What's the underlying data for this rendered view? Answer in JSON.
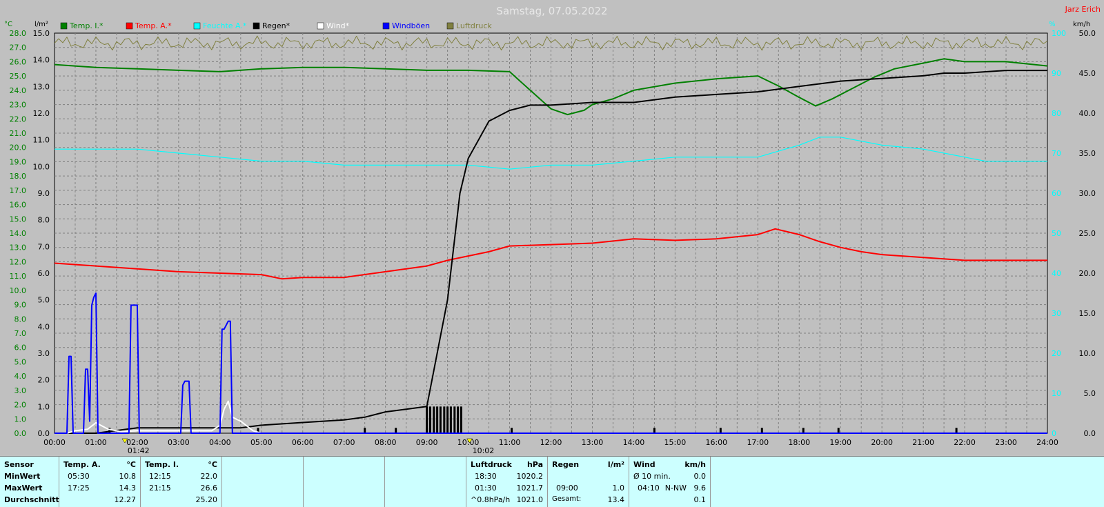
{
  "title": "Samstag, 07.05.2022",
  "author": "Jarz Erich",
  "axes": {
    "left1_unit": "°C",
    "left2_unit": "l/m²",
    "right1_unit": "%",
    "right2_unit": "km/h",
    "left1_ticks": [
      "0.0",
      "1.0",
      "2.0",
      "3.0",
      "4.0",
      "5.0",
      "6.0",
      "7.0",
      "8.0",
      "9.0",
      "10.0",
      "11.0",
      "12.0",
      "13.0",
      "14.0",
      "15.0",
      "16.0",
      "17.0",
      "18.0",
      "19.0",
      "20.0",
      "21.0",
      "22.0",
      "23.0",
      "24.0",
      "25.0",
      "26.0",
      "27.0",
      "28.0"
    ],
    "left2_ticks": [
      "0.0",
      "1.0",
      "2.0",
      "3.0",
      "4.0",
      "5.0",
      "6.0",
      "7.0",
      "8.0",
      "9.0",
      "10.0",
      "11.0",
      "12.0",
      "13.0",
      "14.0",
      "15.0"
    ],
    "right1_ticks": [
      "0",
      "10",
      "20",
      "30",
      "40",
      "50",
      "60",
      "70",
      "80",
      "90",
      "100"
    ],
    "right2_ticks": [
      "0.0",
      "5.0",
      "10.0",
      "15.0",
      "20.0",
      "25.0",
      "30.0",
      "35.0",
      "40.0",
      "45.0",
      "50.0"
    ],
    "x_ticks": [
      "00:00",
      "01:00",
      "02:00",
      "03:00",
      "04:00",
      "05:00",
      "06:00",
      "07:00",
      "08:00",
      "09:00",
      "10:00",
      "11:00",
      "12:00",
      "13:00",
      "14:00",
      "15:00",
      "16:00",
      "17:00",
      "18:00",
      "19:00",
      "20:00",
      "21:00",
      "22:00",
      "23:00",
      "24:00"
    ],
    "sunrise": "01:42",
    "sunset": "10:02"
  },
  "colors": {
    "temp_i": "#008000",
    "temp_a": "#ff0000",
    "feuchte": "#00ffff",
    "regen": "#000000",
    "wind": "#ffffff",
    "windboeen": "#0000ff",
    "luftdruck": "#808040",
    "title": "#e8e8e8",
    "author": "#ff0000",
    "left_axis": "#008000",
    "right1_axis": "#00ffff"
  },
  "legend": [
    {
      "label": "Temp. I.*",
      "color": "#008000"
    },
    {
      "label": "Temp. A.*",
      "color": "#ff0000"
    },
    {
      "label": "Feuchte A.*",
      "color": "#00ffff"
    },
    {
      "label": "Regen*",
      "color": "#000000"
    },
    {
      "label": "Wind*",
      "color": "#ffffff"
    },
    {
      "label": "Windböen",
      "color": "#0000ff"
    },
    {
      "label": "Luftdruck",
      "color": "#808040"
    }
  ],
  "chart_data": {
    "type": "line",
    "x_unit": "hour",
    "xlim": [
      0,
      24
    ],
    "series": [
      {
        "name": "Temp. I.*",
        "axis": "left1",
        "ylim": [
          0,
          28
        ],
        "x": [
          0,
          1,
          2,
          3,
          4,
          5,
          6,
          7,
          8,
          9,
          10,
          11,
          11.5,
          12,
          12.4,
          12.8,
          13,
          13.5,
          14,
          15,
          16,
          17,
          17.5,
          18,
          18.4,
          18.8,
          19.2,
          19.8,
          20.3,
          21,
          21.5,
          22,
          23,
          24
        ],
        "y": [
          25.8,
          25.6,
          25.5,
          25.4,
          25.3,
          25.5,
          25.6,
          25.6,
          25.5,
          25.4,
          25.4,
          25.3,
          24.0,
          22.7,
          22.3,
          22.6,
          23.0,
          23.4,
          24.0,
          24.5,
          24.8,
          25.0,
          24.3,
          23.5,
          22.9,
          23.4,
          24.0,
          24.9,
          25.5,
          25.9,
          26.2,
          26.0,
          26.0,
          25.7
        ]
      },
      {
        "name": "Temp. A.*",
        "axis": "left1",
        "ylim": [
          0,
          28
        ],
        "x": [
          0,
          1,
          2,
          3,
          4,
          5,
          5.5,
          6,
          7,
          8,
          9,
          9.5,
          10,
          10.5,
          11,
          12,
          13,
          14,
          15,
          16,
          17,
          17.42,
          18,
          18.5,
          19,
          19.5,
          20,
          21,
          22,
          23,
          24
        ],
        "y": [
          11.9,
          11.7,
          11.5,
          11.3,
          11.2,
          11.1,
          10.8,
          10.9,
          10.9,
          11.3,
          11.7,
          12.1,
          12.4,
          12.7,
          13.1,
          13.2,
          13.3,
          13.6,
          13.5,
          13.6,
          13.9,
          14.3,
          13.9,
          13.4,
          13.0,
          12.7,
          12.5,
          12.3,
          12.1,
          12.1,
          12.1
        ]
      },
      {
        "name": "Feuchte A.*",
        "axis": "right1",
        "ylim": [
          0,
          100
        ],
        "x": [
          0,
          1,
          2,
          3,
          4,
          5,
          6,
          7,
          8,
          9,
          10,
          11,
          12,
          13,
          14,
          15,
          16,
          17,
          18,
          18.5,
          19,
          20,
          21,
          22,
          22.5,
          23,
          24
        ],
        "y": [
          71,
          71,
          71,
          70,
          69,
          68,
          68,
          67,
          67,
          67,
          67,
          66,
          67,
          67,
          68,
          69,
          69,
          69,
          72,
          74,
          74,
          72,
          71,
          69,
          68,
          68,
          68
        ]
      },
      {
        "name": "Regen*",
        "axis": "left2",
        "ylim": [
          0,
          15
        ],
        "x": [
          0,
          1,
          2,
          3,
          4,
          4.5,
          5,
          6,
          7,
          7.5,
          8,
          8.5,
          9,
          9.5,
          9.8,
          10,
          10.25,
          10.5,
          11,
          11.5,
          12,
          13,
          14,
          15,
          16,
          17,
          18,
          19,
          20,
          21,
          21.5,
          22,
          23,
          24
        ],
        "y": [
          0,
          0,
          0.2,
          0.2,
          0.2,
          0.2,
          0.3,
          0.4,
          0.5,
          0.6,
          0.8,
          0.9,
          1.0,
          5.0,
          9.0,
          10.3,
          11.0,
          11.7,
          12.1,
          12.3,
          12.3,
          12.4,
          12.4,
          12.6,
          12.7,
          12.8,
          13.0,
          13.2,
          13.3,
          13.4,
          13.5,
          13.5,
          13.6,
          13.6
        ]
      },
      {
        "name": "Wind*",
        "axis": "right2",
        "ylim": [
          0,
          50
        ],
        "x": [
          0,
          0.3,
          0.5,
          0.8,
          1.0,
          1.3,
          1.6,
          2.0,
          2.5,
          3.0,
          3.5,
          3.8,
          4.0,
          4.1,
          4.2,
          4.3,
          4.5,
          4.8,
          5.0,
          24
        ],
        "y": [
          0,
          0,
          0.3,
          0.5,
          1.3,
          0.5,
          0.2,
          0.3,
          0.3,
          0.3,
          0.3,
          0.3,
          1.0,
          3.0,
          4.0,
          2.0,
          1.5,
          0.3,
          0,
          0
        ]
      },
      {
        "name": "Windböen",
        "axis": "right2",
        "ylim": [
          0,
          50
        ],
        "x": [
          0,
          0.3,
          0.35,
          0.4,
          0.45,
          0.55,
          0.7,
          0.75,
          0.8,
          0.85,
          0.9,
          0.95,
          1.0,
          1.05,
          1.1,
          1.5,
          1.8,
          1.85,
          1.9,
          2.0,
          2.05,
          2.1,
          3.05,
          3.1,
          3.15,
          3.25,
          3.3,
          3.35,
          4.0,
          4.05,
          4.1,
          4.2,
          4.25,
          4.3,
          4.4,
          24
        ],
        "y": [
          0,
          0,
          9.6,
          9.6,
          0,
          0,
          0,
          8.0,
          8.0,
          1.5,
          16.0,
          17.0,
          17.5,
          0,
          0,
          0,
          0,
          16.0,
          16.0,
          16.0,
          0,
          0,
          0,
          6.0,
          6.5,
          6.5,
          0,
          0,
          0,
          13.0,
          13.0,
          14.0,
          14.0,
          0,
          0,
          0
        ]
      },
      {
        "name": "Luftdruck",
        "axis": "right1",
        "ylim": [
          0,
          100
        ],
        "x": [
          0,
          1,
          2,
          3,
          4,
          5,
          6,
          7,
          8,
          9,
          10,
          11,
          12,
          13,
          14,
          15,
          16,
          17,
          18,
          19,
          20,
          21,
          22,
          23,
          24
        ],
        "y": [
          98,
          97,
          98,
          97,
          98,
          97,
          98,
          97,
          98,
          97,
          98,
          97,
          98,
          97,
          98,
          97,
          98,
          97,
          98,
          97,
          98,
          97,
          98,
          97,
          98
        ]
      }
    ],
    "rain_bars": {
      "name": "Regen (Menge je Intervall)",
      "axis": "left2",
      "x": [
        9.0,
        9.08,
        9.17,
        9.25,
        9.33,
        9.42,
        9.5,
        9.58,
        9.67,
        9.75,
        9.83,
        1.33,
        4.92,
        7.5,
        8.25,
        9.0,
        11.05,
        14.5,
        16.1,
        17.1,
        18.1,
        18.95,
        21.8
      ],
      "y": [
        1.0,
        1.0,
        1.0,
        1.0,
        1.0,
        1.0,
        1.0,
        1.0,
        1.0,
        1.0,
        1.0,
        0.2,
        0.2,
        0.2,
        0.2,
        0.2,
        0.2,
        0.2,
        0.2,
        0.2,
        0.2,
        0.2,
        0.2
      ]
    }
  },
  "stats": {
    "sensor": {
      "header": "Sensor",
      "rows": [
        "MinWert",
        "MaxWert",
        "Durchschnitt"
      ]
    },
    "temp_a": {
      "header": "Temp. A.",
      "unit": "°C",
      "rows": [
        {
          "time": "05:30",
          "value": "10.8"
        },
        {
          "time": "17:25",
          "value": "14.3"
        },
        {
          "time": "",
          "value": "12.27"
        }
      ]
    },
    "temp_i": {
      "header": "Temp. I.",
      "unit": "°C",
      "rows": [
        {
          "time": "12:15",
          "value": "22.0"
        },
        {
          "time": "21:15",
          "value": "26.6"
        },
        {
          "time": "",
          "value": "25.20"
        }
      ]
    },
    "luftdruck": {
      "header": "Luftdruck",
      "unit": "hPa",
      "rows": [
        {
          "time": "18:30",
          "value": "1020.2"
        },
        {
          "time": "01:30",
          "value": "1021.7"
        },
        {
          "time": "^0.8hPa/h",
          "value": "1021.0"
        }
      ]
    },
    "regen": {
      "header": "Regen",
      "unit": "l/m²",
      "rows": [
        {
          "time": "",
          "value": ""
        },
        {
          "time": "09:00",
          "value": "1.0"
        },
        {
          "time": "Gesamt:",
          "value": "13.4"
        }
      ]
    },
    "wind": {
      "header": "Wind",
      "unit": "km/h",
      "rows": [
        {
          "time": "Ø 10 min.",
          "dir": "",
          "value": "0.0"
        },
        {
          "time": "04:10",
          "dir": "N-NW",
          "value": "9.6"
        },
        {
          "time": "",
          "dir": "",
          "value": "0.1"
        }
      ]
    }
  }
}
